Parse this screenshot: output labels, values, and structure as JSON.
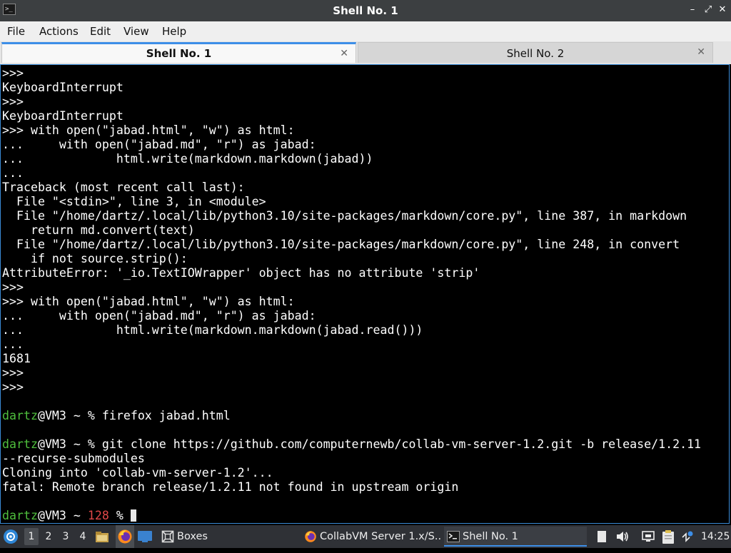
{
  "window": {
    "title": "Shell No. 1",
    "controls": {
      "minimize": "–",
      "maximize": "⤢",
      "close": "✕"
    }
  },
  "menu": [
    "File",
    "Actions",
    "Edit",
    "View",
    "Help"
  ],
  "tabs": [
    {
      "label": "Shell No. 1",
      "active": true,
      "close": "✕"
    },
    {
      "label": "Shell No. 2",
      "active": false,
      "close": "✕"
    }
  ],
  "terminal": {
    "colors": {
      "user": "#4fbf3d",
      "error_code": "#e04848"
    },
    "lines": [
      [
        {
          "t": ">>>"
        }
      ],
      [
        {
          "t": "KeyboardInterrupt"
        }
      ],
      [
        {
          "t": ">>>"
        }
      ],
      [
        {
          "t": "KeyboardInterrupt"
        }
      ],
      [
        {
          "t": ">>> with open(\"jabad.html\", \"w\") as html:"
        }
      ],
      [
        {
          "t": "...     with open(\"jabad.md\", \"r\") as jabad:"
        }
      ],
      [
        {
          "t": "...             html.write(markdown.markdown(jabad))"
        }
      ],
      [
        {
          "t": "..."
        }
      ],
      [
        {
          "t": "Traceback (most recent call last):"
        }
      ],
      [
        {
          "t": "  File \"<stdin>\", line 3, in <module>"
        }
      ],
      [
        {
          "t": "  File \"/home/dartz/.local/lib/python3.10/site-packages/markdown/core.py\", line 387, in markdown"
        }
      ],
      [
        {
          "t": "    return md.convert(text)"
        }
      ],
      [
        {
          "t": "  File \"/home/dartz/.local/lib/python3.10/site-packages/markdown/core.py\", line 248, in convert"
        }
      ],
      [
        {
          "t": "    if not source.strip():"
        }
      ],
      [
        {
          "t": "AttributeError: '_io.TextIOWrapper' object has no attribute 'strip'"
        }
      ],
      [
        {
          "t": ">>>"
        }
      ],
      [
        {
          "t": ">>> with open(\"jabad.html\", \"w\") as html:"
        }
      ],
      [
        {
          "t": "...     with open(\"jabad.md\", \"r\") as jabad:"
        }
      ],
      [
        {
          "t": "...             html.write(markdown.markdown(jabad.read()))"
        }
      ],
      [
        {
          "t": "..."
        }
      ],
      [
        {
          "t": "1681"
        }
      ],
      [
        {
          "t": ">>>"
        }
      ],
      [
        {
          "t": ">>>"
        }
      ],
      [
        {
          "t": ""
        }
      ],
      [
        {
          "t": "dartz",
          "c": "u"
        },
        {
          "t": "@VM3 ~ % firefox jabad.html"
        }
      ],
      [
        {
          "t": ""
        }
      ],
      [
        {
          "t": "dartz",
          "c": "u"
        },
        {
          "t": "@VM3 ~ % git clone https://github.com/computernewb/collab-vm-server-1.2.git -b release/1.2.11"
        }
      ],
      [
        {
          "t": "--recurse-submodules"
        }
      ],
      [
        {
          "t": "Cloning into 'collab-vm-server-1.2'..."
        }
      ],
      [
        {
          "t": "fatal: Remote branch release/1.2.11 not found in upstream origin"
        }
      ],
      [
        {
          "t": ""
        }
      ],
      [
        {
          "t": "dartz",
          "c": "u"
        },
        {
          "t": "@VM3 ~ "
        },
        {
          "t": "128",
          "c": "e"
        },
        {
          "t": " % "
        },
        {
          "cursor": true
        }
      ]
    ]
  },
  "taskbar": {
    "workspaces": [
      "1",
      "2",
      "3",
      "4"
    ],
    "active_workspace": "1",
    "boxes_label": "Boxes",
    "windows": [
      {
        "label": "CollabVM Server 1.x/S...",
        "icon": "firefox-icon",
        "active": false
      },
      {
        "label": "Shell No. 1",
        "icon": "terminal-icon",
        "active": true
      }
    ],
    "clock": "14:25"
  }
}
